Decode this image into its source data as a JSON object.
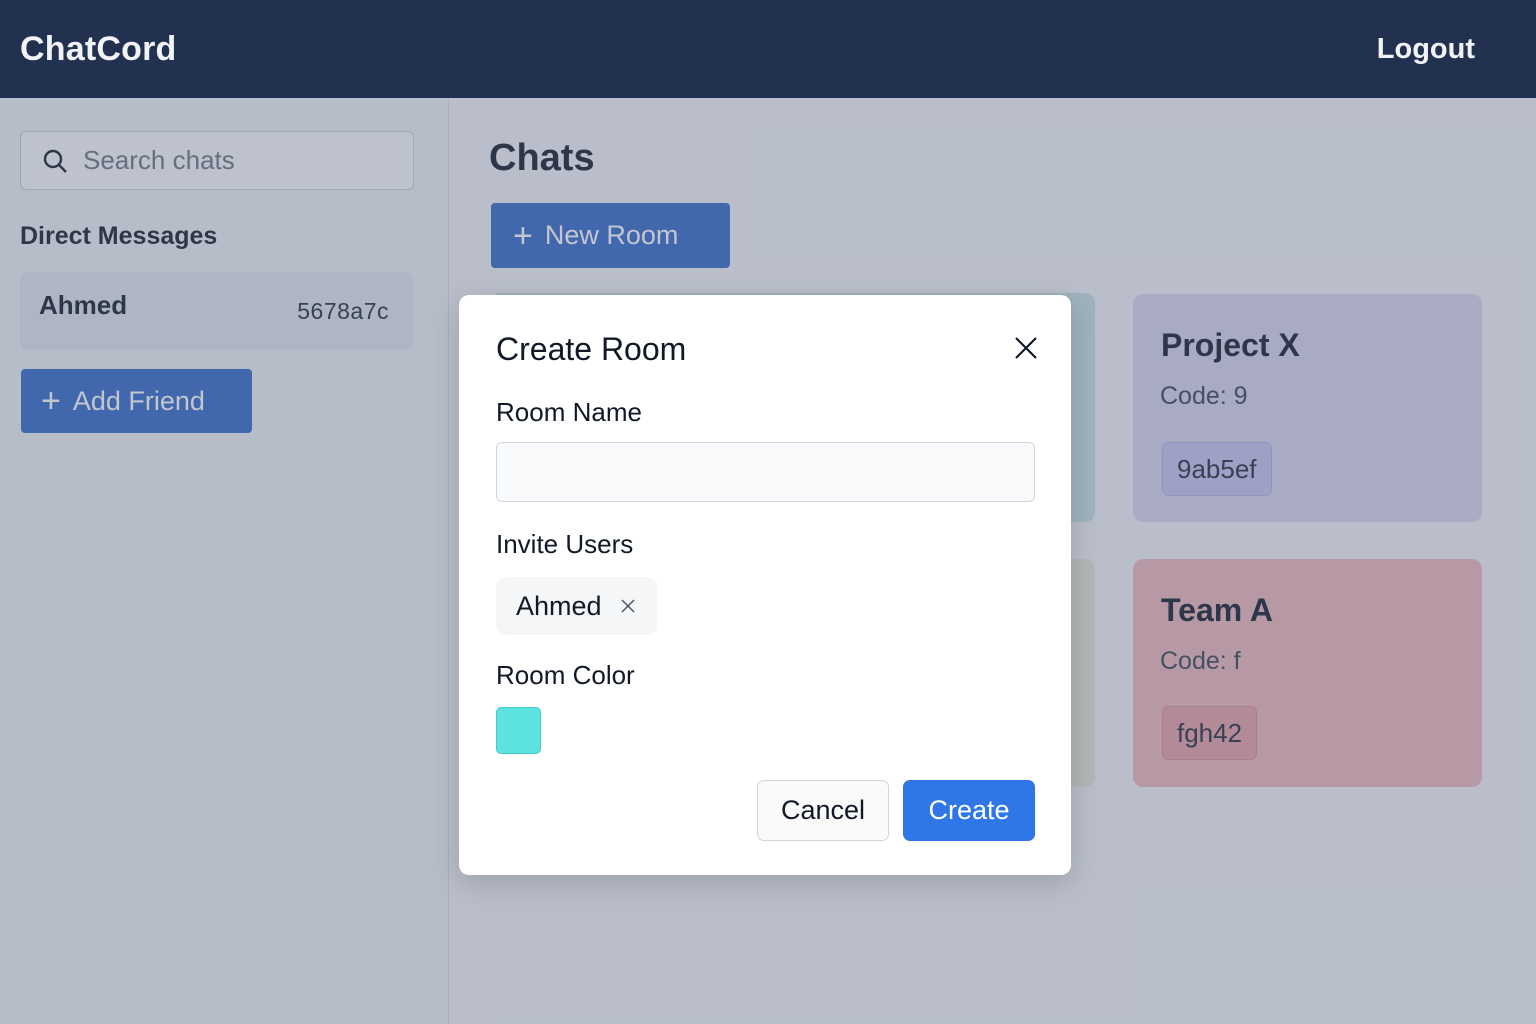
{
  "app": {
    "brand": "ChatCord",
    "logout_label": "Logout"
  },
  "sidebar": {
    "search_placeholder": "Search chats",
    "section_title": "Direct Messages",
    "direct_messages": [
      {
        "name": "Ahmed",
        "code": "5678a7c"
      }
    ],
    "add_friend_label": "Add Friend"
  },
  "main": {
    "title": "Chats",
    "new_room_label": "New Room",
    "rooms": [
      {
        "title": "Project X",
        "code_label": "Code: 9",
        "code_chip": "9ab5ef",
        "color": "#d7d4ee"
      },
      {
        "title": "Team A",
        "code_label": "Code: f",
        "code_chip": "fgh42",
        "color": "#edb6bc"
      }
    ],
    "hidden_room_colors": [
      "#c6e0e4",
      "#e7e5d8"
    ]
  },
  "modal": {
    "title": "Create Room",
    "room_name_label": "Room Name",
    "room_name_value": "",
    "invite_label": "Invite Users",
    "invited_users": [
      "Ahmed"
    ],
    "color_label": "Room Color",
    "selected_color": "#5ce3df",
    "cancel_label": "Cancel",
    "create_label": "Create"
  },
  "colors": {
    "topbar": "#22314f",
    "primary": "#2f66c9",
    "create_button": "#2f77e8"
  }
}
